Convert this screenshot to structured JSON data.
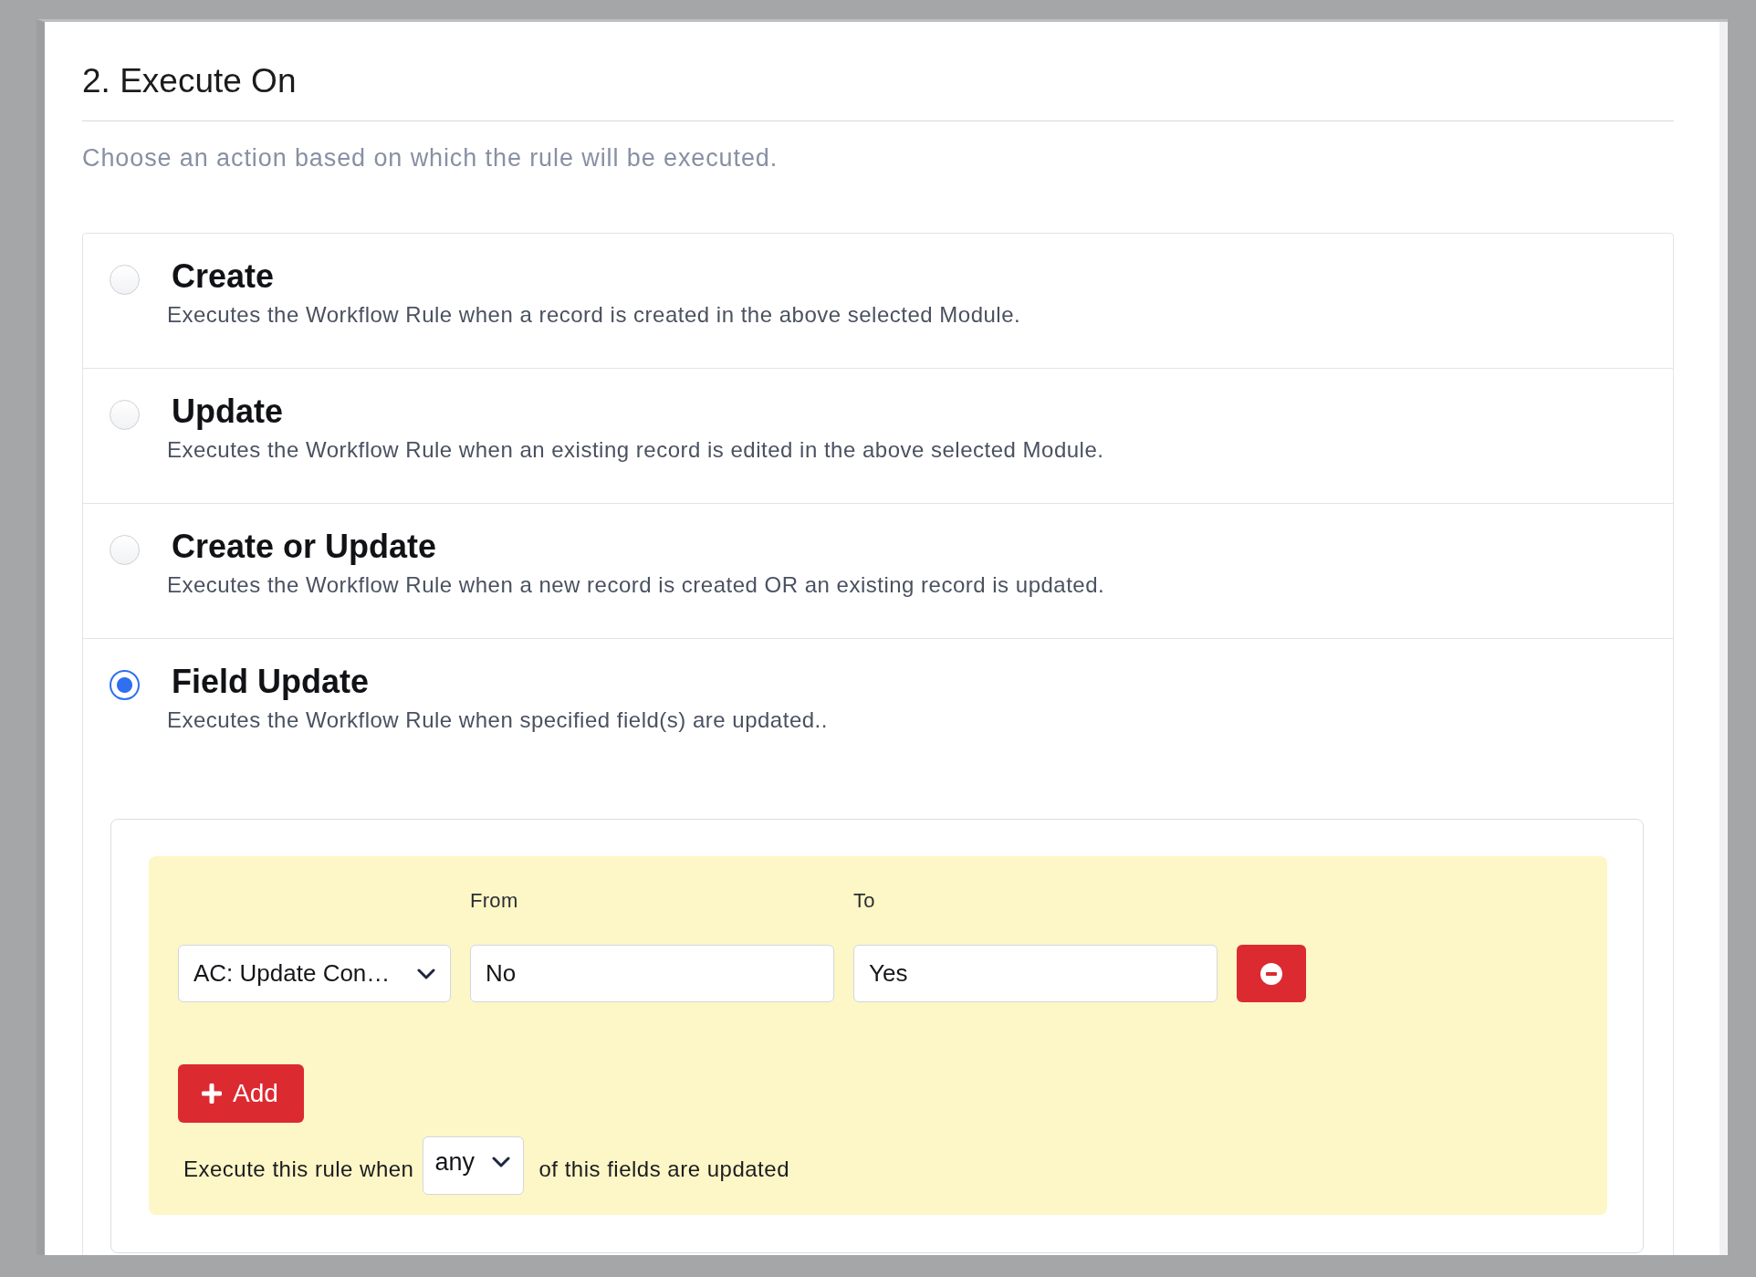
{
  "section": {
    "title": "2. Execute On",
    "subtitle": "Choose an action based on which the rule will be executed."
  },
  "options": [
    {
      "title": "Create",
      "description": "Executes the Workflow Rule when a record is created in the above selected Module.",
      "selected": false
    },
    {
      "title": "Update",
      "description": "Executes the Workflow Rule when an existing record is edited in the above selected Module.",
      "selected": false
    },
    {
      "title": "Create or Update",
      "description": "Executes the Workflow Rule when a new record is created OR an existing record is updated.",
      "selected": false
    },
    {
      "title": "Field Update",
      "description": "Executes the Workflow Rule when specified field(s) are updated..",
      "selected": true,
      "conditions": {
        "from_label": "From",
        "to_label": "To",
        "rows": [
          {
            "field": "AC: Update Con…",
            "from": "No",
            "to": "Yes"
          }
        ],
        "add_button": "Add",
        "rule": {
          "prefix": "Execute this rule when",
          "match": "any",
          "suffix": "of this fields are updated"
        }
      }
    }
  ]
}
